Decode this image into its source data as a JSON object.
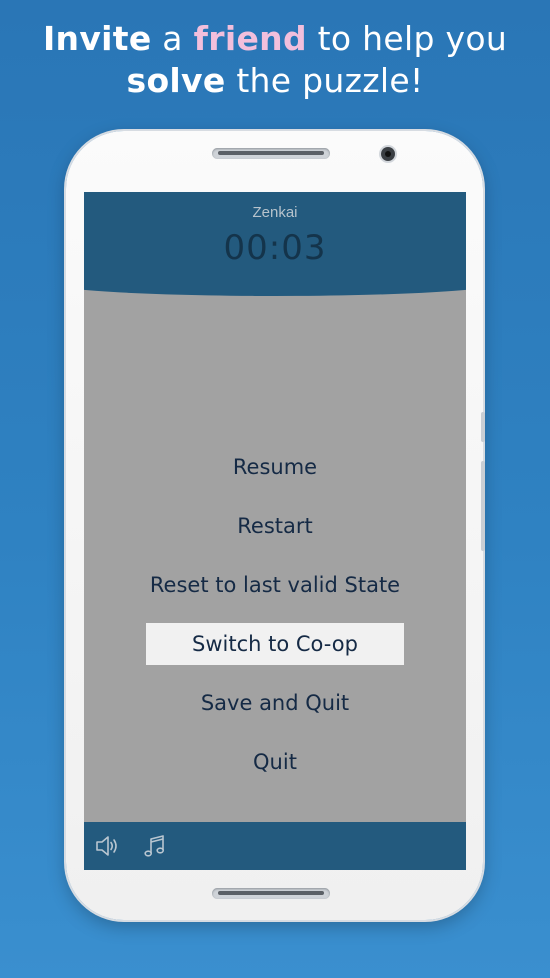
{
  "headline": {
    "line1": [
      "Invite",
      " a ",
      "friend",
      " to help you"
    ],
    "line2": [
      "solve",
      " the puzzle!"
    ]
  },
  "game": {
    "level_name": "Zenkai",
    "timer": "00:03"
  },
  "menu": {
    "items": [
      {
        "label": "Resume"
      },
      {
        "label": "Restart"
      },
      {
        "label": "Reset to last valid State"
      },
      {
        "label": "Switch to Co-op",
        "selected": true
      },
      {
        "label": "Save and Quit"
      },
      {
        "label": "Quit"
      }
    ]
  },
  "bottom_bar": {
    "icons": [
      "speaker-icon",
      "music-note-icon"
    ]
  },
  "colors": {
    "background": "#2f82c2",
    "highlight_word": "#f2bfdc",
    "header": "#235a7e",
    "screen_overlay": "#a2a2a2",
    "menu_text": "#152a45",
    "selected_item_bg": "#f1f1f1"
  }
}
